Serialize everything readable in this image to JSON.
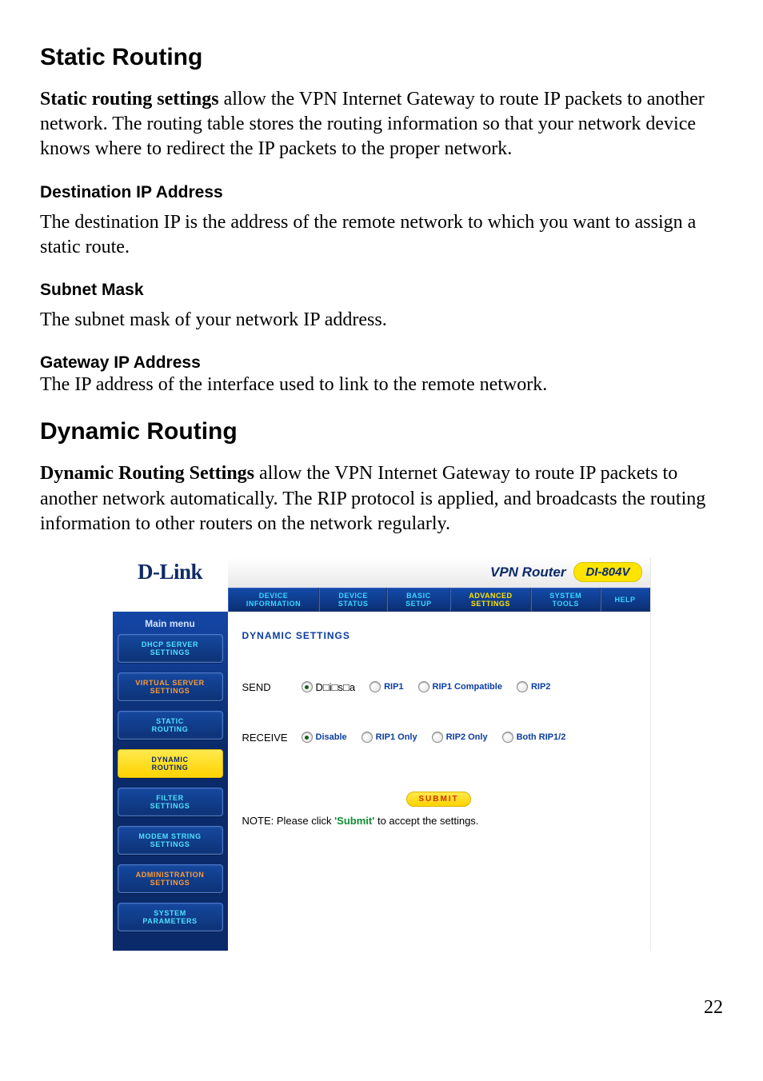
{
  "page_number": "22",
  "headings": {
    "static_routing": "Static Routing",
    "dynamic_routing": "Dynamic Routing",
    "dest_ip": "Destination IP Address",
    "subnet_mask": "Subnet Mask",
    "gateway_ip": "Gateway IP Address"
  },
  "paragraphs": {
    "static_lead_bold": "Static routing settings",
    "static_lead_rest": " allow the VPN Internet Gateway to route IP packets to another network. The routing table stores the routing information so that your network device knows where to redirect the IP packets to the proper network.",
    "dest_ip_body": "The destination IP is the address of the remote network to which you want to assign a static route.",
    "subnet_mask_body": "The subnet mask of your network IP address.",
    "gateway_ip_body": "The IP address of the interface used to link to the remote network.",
    "dynamic_lead_bold": "Dynamic Routing Settings",
    "dynamic_lead_rest": " allow the VPN Internet Gateway to route IP packets to another network automatically. The RIP protocol is applied, and broadcasts the routing information to other routers on the network regularly."
  },
  "router_ui": {
    "logo": "D-Link",
    "brand_title": "VPN Router",
    "model": "DI-804V",
    "tabs": [
      {
        "line1": "DEVICE",
        "line2": "INFORMATION",
        "active": false
      },
      {
        "line1": "DEVICE",
        "line2": "STATUS",
        "active": false
      },
      {
        "line1": "BASIC",
        "line2": "SETUP",
        "active": false
      },
      {
        "line1": "ADVANCED",
        "line2": "SETTINGS",
        "active": true
      },
      {
        "line1": "SYSTEM",
        "line2": "TOOLS",
        "active": false
      },
      {
        "line1": "HELP",
        "line2": "",
        "active": false
      }
    ],
    "sidebar": {
      "title": "Main menu",
      "items": [
        {
          "line1": "DHCP SERVER",
          "line2": "SETTINGS",
          "style": "normal"
        },
        {
          "line1": "VIRTUAL SERVER",
          "line2": "SETTINGS",
          "style": "orange"
        },
        {
          "line1": "STATIC",
          "line2": "ROUTING",
          "style": "normal"
        },
        {
          "line1": "DYNAMIC",
          "line2": "ROUTING",
          "style": "active"
        },
        {
          "line1": "FILTER",
          "line2": "SETTINGS",
          "style": "normal"
        },
        {
          "line1": "MODEM STRING",
          "line2": "SETTINGS",
          "style": "normal"
        },
        {
          "line1": "ADMINISTRATION",
          "line2": "SETTINGS",
          "style": "orange"
        },
        {
          "line1": "SYSTEM",
          "line2": "PARAMETERS",
          "style": "normal"
        }
      ]
    },
    "content": {
      "title": "DYNAMIC SETTINGS",
      "rows": {
        "send": {
          "label": "SEND",
          "options": [
            "D□i□s□a",
            "RIP1",
            "RIP1 Compatible",
            "RIP2"
          ],
          "selected_index": 0
        },
        "receive": {
          "label": "RECEIVE",
          "options": [
            "Disable",
            "RIP1 Only",
            "RIP2 Only",
            "Both RIP1/2"
          ],
          "selected_index": 0
        }
      },
      "submit": "SUBMIT",
      "note_prefix": "NOTE: Please click ",
      "note_bold": "'Submit'",
      "note_suffix": " to accept the settings."
    }
  }
}
